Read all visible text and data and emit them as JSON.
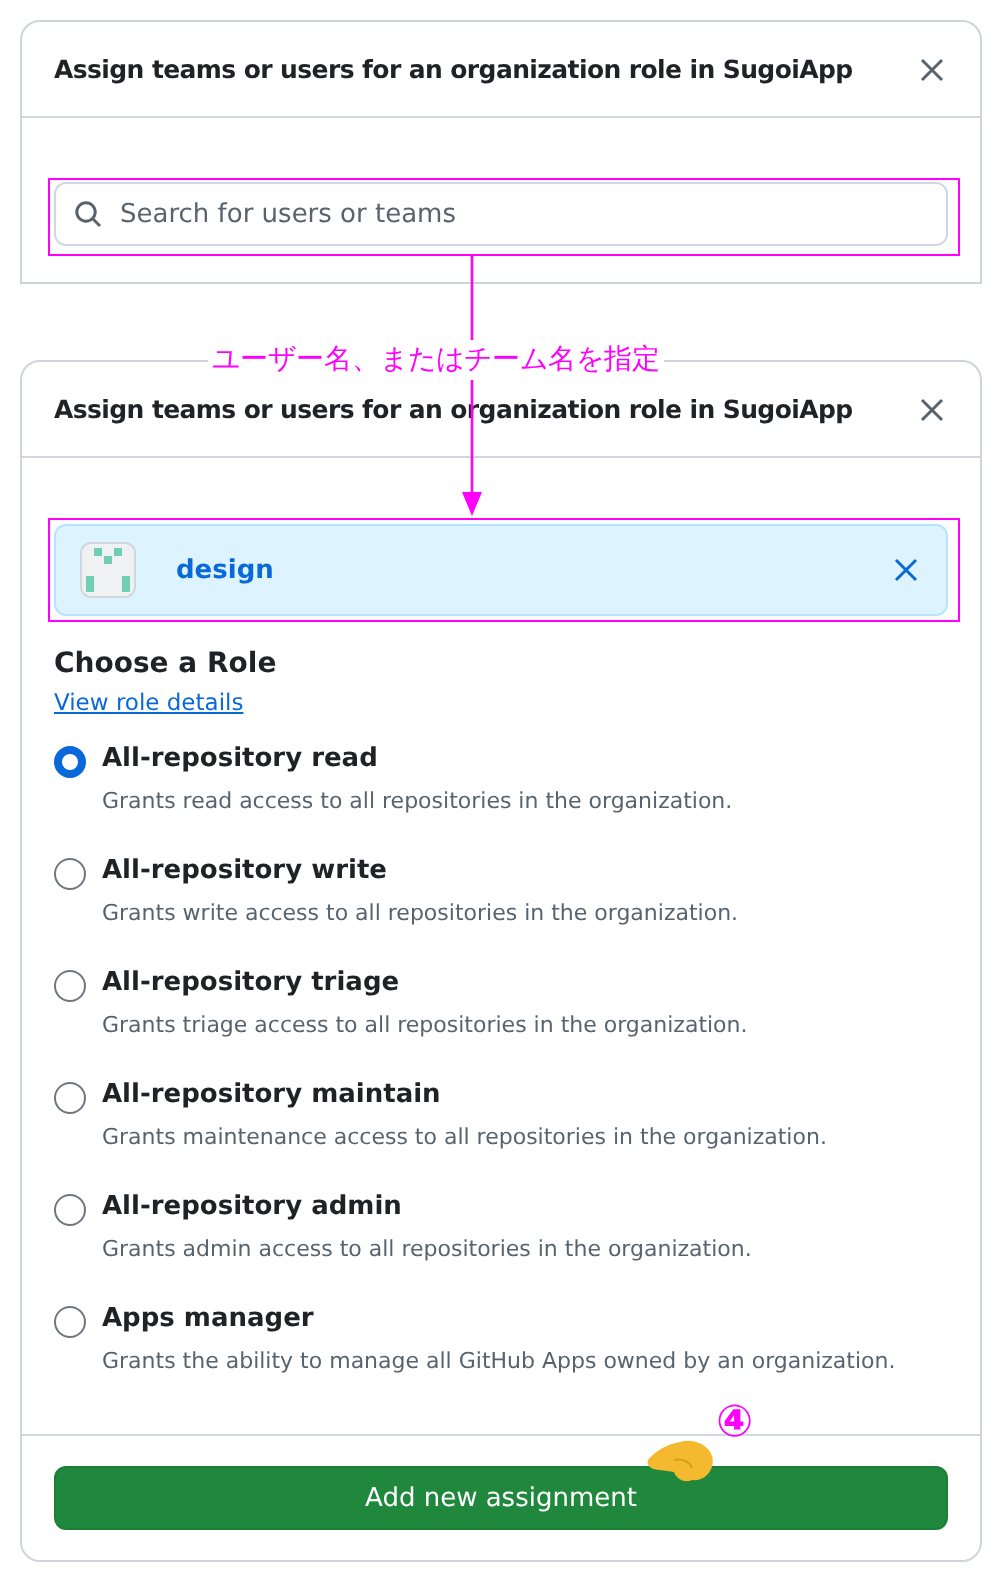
{
  "search_dialog": {
    "title": "Assign teams or users for an organization role in SugoiApp",
    "search": {
      "placeholder": "Search for users or teams"
    }
  },
  "assign_dialog": {
    "title": "Assign teams or users for an organization role in SugoiApp",
    "selected_team": {
      "name": "design"
    },
    "heading": "Choose a Role",
    "link": "View role details",
    "roles": [
      {
        "name": "All-repository read",
        "description": "Grants read access to all repositories in the organization.",
        "selected": true
      },
      {
        "name": "All-repository write",
        "description": "Grants write access to all repositories in the organization.",
        "selected": false
      },
      {
        "name": "All-repository triage",
        "description": "Grants triage access to all repositories in the organization.",
        "selected": false
      },
      {
        "name": "All-repository maintain",
        "description": "Grants maintenance access to all repositories in the organization.",
        "selected": false
      },
      {
        "name": "All-repository admin",
        "description": "Grants admin access to all repositories in the organization.",
        "selected": false
      },
      {
        "name": "Apps manager",
        "description": "Grants the ability to manage all GitHub Apps owned by an organization.",
        "selected": false
      }
    ],
    "button": "Add new assignment"
  },
  "annotations": {
    "callout": "ユーザー名、またはチーム名を指定",
    "step": "④"
  }
}
